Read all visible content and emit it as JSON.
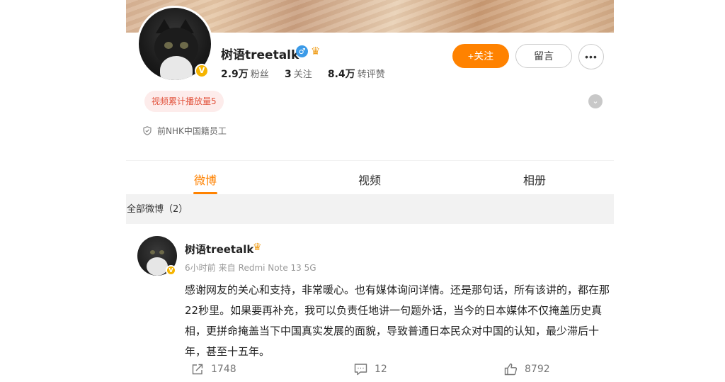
{
  "profile": {
    "name": "树语treetalk",
    "gender_icon": "male-icon",
    "verified_icon": "v-badge-icon",
    "vip_icon": "crown-icon",
    "stats": [
      {
        "value": "2.9万",
        "label": "粉丝"
      },
      {
        "value": "3",
        "label": "关注"
      },
      {
        "value": "8.4万",
        "label": "转评赞"
      }
    ],
    "follow_label": "+关注",
    "message_label": "留言",
    "more_label": "•••",
    "video_pill": "视频累计播放量5",
    "description": "前NHK中国籍员工"
  },
  "tabs": [
    {
      "label": "微博",
      "active": true
    },
    {
      "label": "视频",
      "active": false
    },
    {
      "label": "相册",
      "active": false
    }
  ],
  "section_title": "全部微博（2）",
  "post": {
    "author": "树语treetalk",
    "time": "6小时前",
    "source_prefix": "来自",
    "source": "Redmi Note 13 5G",
    "text": "感谢网友的关心和支持，非常暖心。也有媒体询问详情。还是那句话，所有该讲的，都在那22秒里。如果要再补充，我可以负责任地讲一句题外话，当今的日本媒体不仅掩盖历史真相，更拼命掩盖当下中国真实发展的面貌，导致普通日本民众对中国的认知，最少滞后十年，甚至十五年。",
    "reposts": "1748",
    "comments": "12",
    "likes": "8792"
  },
  "colors": {
    "accent": "#ff8200",
    "pill_bg": "#fdeceb",
    "pill_text": "#e2533d",
    "section_bg": "#f2f2f2"
  }
}
